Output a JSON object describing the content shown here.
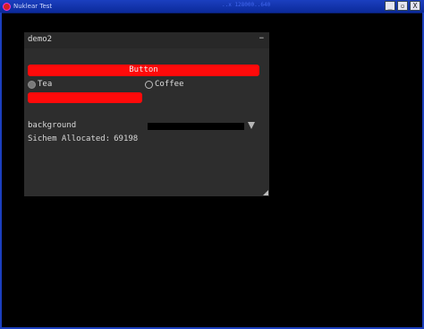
{
  "os_window": {
    "title": "Nuklear Test",
    "status_text": "..x 128000..640",
    "controls": [
      "_",
      "▫",
      "X"
    ]
  },
  "demo_window": {
    "title": "demo2",
    "minimize_label": "−",
    "button_label": "Button",
    "radio_options": [
      {
        "label": "Tea",
        "selected": true
      },
      {
        "label": "Coffee",
        "selected": false
      }
    ],
    "slider_value": 0.5,
    "background_label": "background",
    "background_color": "#000000",
    "allocation_label": "Sichem Allocated:",
    "allocation_value": "69198"
  },
  "colors": {
    "accent_red": "#ff0a0a",
    "window_bg": "#2d2d2d",
    "header_bg": "#282828",
    "os_frame": "#1b3fbf"
  }
}
